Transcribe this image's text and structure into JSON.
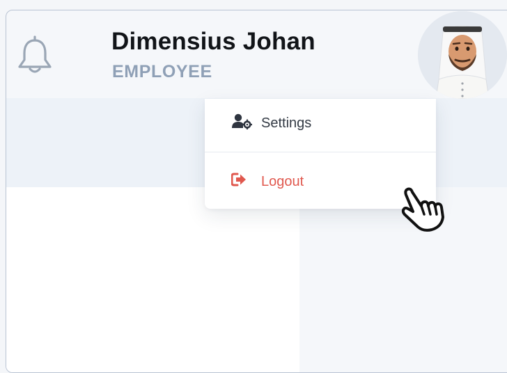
{
  "user": {
    "name": "Dimensius Johan",
    "role": "EMPLOYEE"
  },
  "header": {
    "notification_icon": "bell-outline-icon",
    "avatar": "user-avatar-illustration"
  },
  "dropdown": {
    "items": [
      {
        "label": "Settings",
        "icon": "user-gear-icon",
        "color": "#333a44"
      },
      {
        "label": "Logout",
        "icon": "sign-out-icon",
        "color": "#e0584e"
      }
    ]
  },
  "cursor": {
    "icon": "pointing-hand-cursor-icon"
  },
  "colors": {
    "background": "#f5f7fa",
    "band": "#edf2f8",
    "panel": "#ffffff",
    "role_text": "#8fa0b6",
    "logout_accent": "#e0584e",
    "frame_border": "#b9c3d3"
  }
}
